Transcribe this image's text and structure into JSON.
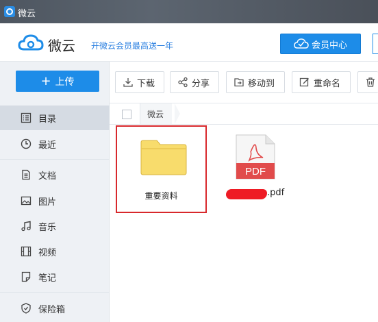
{
  "window": {
    "title": "微云"
  },
  "header": {
    "brand": "微云",
    "promo": "开微云会员最高送一年",
    "vip_button": "会员中心"
  },
  "sidebar": {
    "upload": "上传",
    "items": [
      {
        "label": "目录",
        "icon": "list-icon",
        "active": true
      },
      {
        "label": "最近",
        "icon": "clock-icon"
      },
      {
        "label": "文档",
        "icon": "document-icon"
      },
      {
        "label": "图片",
        "icon": "image-icon"
      },
      {
        "label": "音乐",
        "icon": "music-icon"
      },
      {
        "label": "视频",
        "icon": "video-icon"
      },
      {
        "label": "笔记",
        "icon": "note-icon"
      },
      {
        "label": "保险箱",
        "icon": "shield-icon"
      }
    ]
  },
  "toolbar": {
    "download": "下载",
    "share": "分享",
    "move": "移动到",
    "rename": "重命名"
  },
  "breadcrumb": {
    "current": "微云"
  },
  "files": [
    {
      "name": "重要资料",
      "type": "folder",
      "selected": true
    },
    {
      "name_suffix": ".pdf",
      "type": "pdf",
      "badge": "PDF",
      "name_redacted": true
    }
  ],
  "colors": {
    "accent": "#1d8ce8",
    "selection": "#d8282c",
    "pdf": "#e14b4b",
    "folder": "#f8dc6c"
  }
}
